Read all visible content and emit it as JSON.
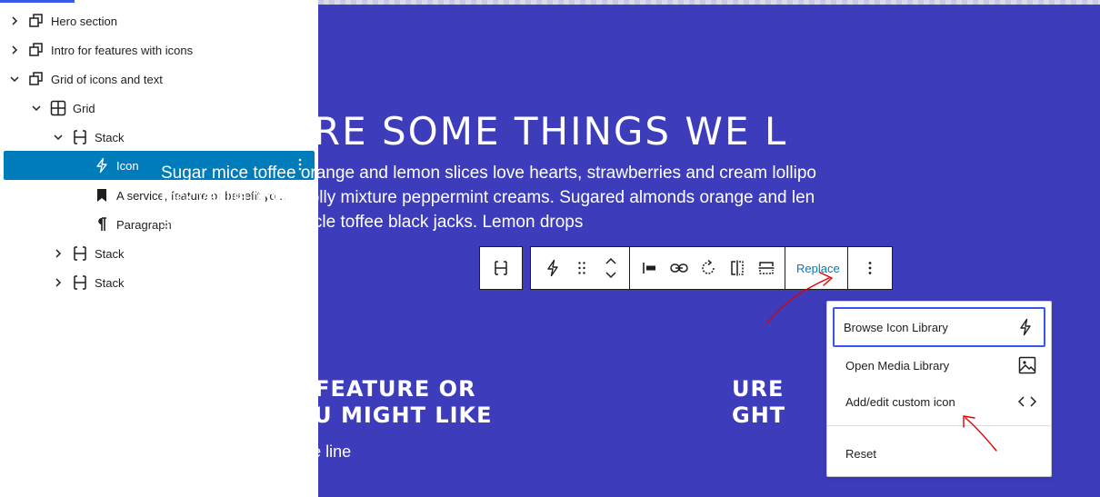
{
  "list_view": {
    "items": [
      {
        "label": "Hero section",
        "type": "group"
      },
      {
        "label": "Intro for features with icons",
        "type": "group"
      },
      {
        "label": "Grid of icons and text",
        "type": "group"
      },
      {
        "label": "Grid",
        "type": "grid"
      },
      {
        "label": "Stack",
        "type": "stack"
      },
      {
        "label": "Icon",
        "type": "icon"
      },
      {
        "label": "A service, feature or benefit yo...",
        "type": "heading"
      },
      {
        "label": "Paragraph",
        "type": "paragraph"
      },
      {
        "label": "Stack",
        "type": "stack"
      },
      {
        "label": "Stack",
        "type": "stack"
      }
    ],
    "selected_item": "Icon"
  },
  "canvas": {
    "background": "#3d3dbc",
    "heading": "HERE ARE SOME THINGS WE L",
    "intro_lines": [
      "Sugar mice toffee orange and lemon slices love hearts, strawberries and cream lollipo",
      "rock vanilla fudge dolly mixture peppermint creams. Sugared almonds orange and len",
      "sherbet lemons treacle toffee black jacks. Lemon drops"
    ],
    "feature_title_lines": [
      "A SERVICE, FEATURE OR",
      "BENEFIT YOU MIGHT LIKE"
    ],
    "feature_title_2_lines": [
      "URE",
      "GHT"
    ],
    "phrase": "A short phrase on one line"
  },
  "toolbar": {
    "replace_label": "Replace",
    "icons": [
      "stack-icon",
      "bolt-icon",
      "drag-handle-icon",
      "move-up-down-icon",
      "align-left-icon",
      "link-icon",
      "rotate-icon",
      "flip-horizontal-icon",
      "flip-vertical-icon",
      "more-options-icon"
    ]
  },
  "replace_menu": {
    "items": [
      {
        "label": "Browse Icon Library",
        "icon": "bolt-icon"
      },
      {
        "label": "Open Media Library",
        "icon": "image-icon"
      },
      {
        "label": "Add/edit custom icon",
        "icon": "code-icon"
      }
    ],
    "reset_label": "Reset"
  },
  "colors": {
    "accent": "#007cba",
    "focus": "#3858e9",
    "canvas": "#3d3dbc",
    "annotation": "#e00000"
  }
}
